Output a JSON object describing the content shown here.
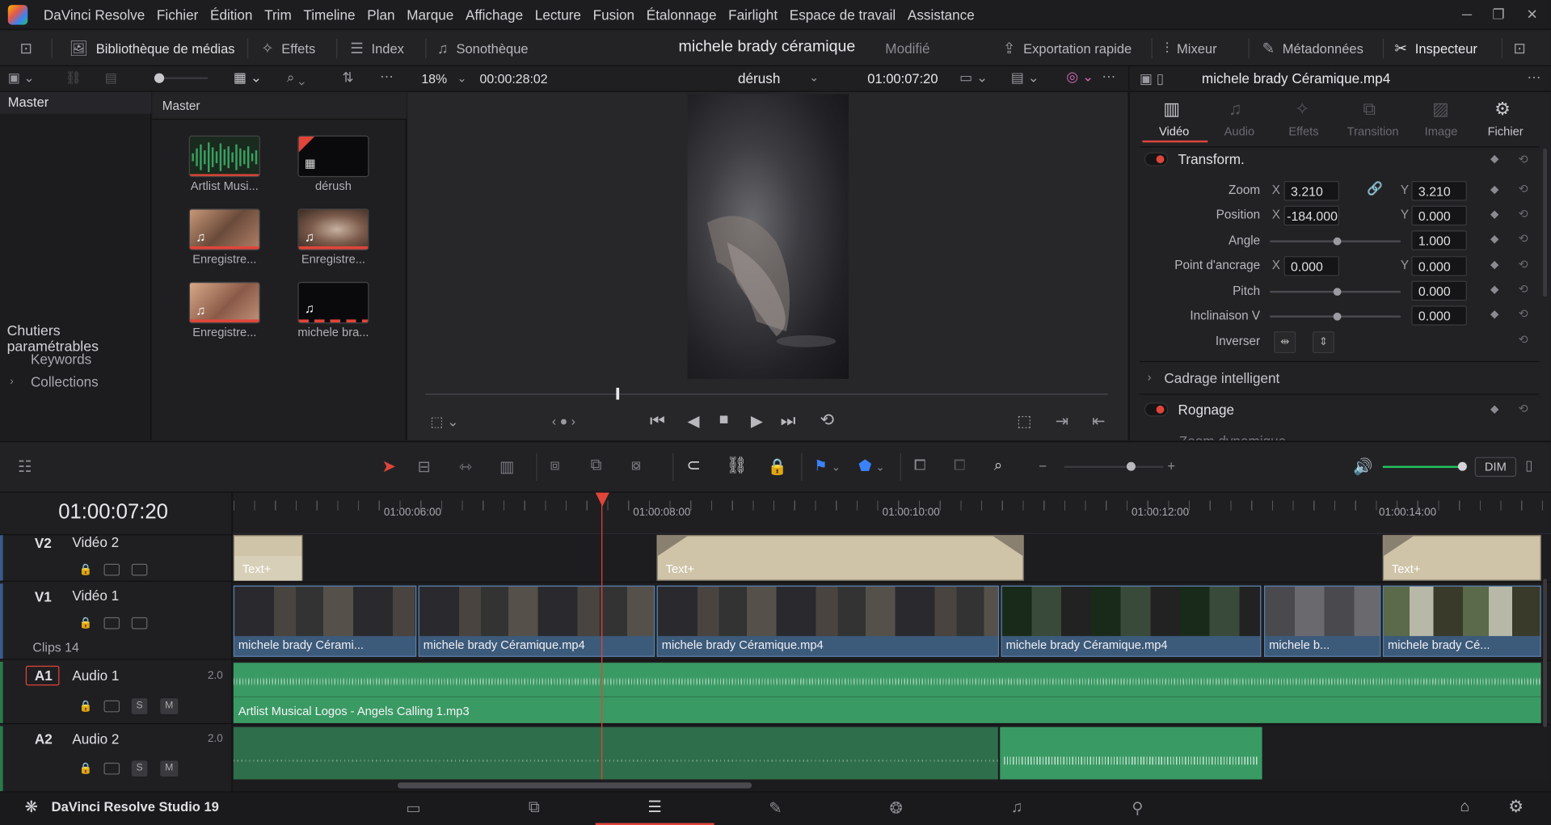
{
  "app": {
    "name": "DaVinci Resolve",
    "footer_name": "DaVinci Resolve Studio 19"
  },
  "menu": [
    "Fichier",
    "Édition",
    "Trim",
    "Timeline",
    "Plan",
    "Marque",
    "Affichage",
    "Lecture",
    "Fusion",
    "Étalonnage",
    "Fairlight",
    "Espace de travail",
    "Assistance"
  ],
  "toolbar": {
    "media_pool": "Bibliothèque de médias",
    "effects": "Effets",
    "index": "Index",
    "sound_library": "Sonothèque",
    "project_title": "michele brady céramique",
    "project_status": "Modifié",
    "quick_export": "Exportation rapide",
    "mixer": "Mixeur",
    "metadata": "Métadonnées",
    "inspector": "Inspecteur"
  },
  "viewer": {
    "zoom": "18%",
    "duration": "00:00:28:02",
    "timeline_name": "dérush",
    "timecode": "01:00:07:20"
  },
  "bins": {
    "master": "Master",
    "smart_bins": "Chutiers paramétrables",
    "keywords": "Keywords",
    "collections": "Collections"
  },
  "media_pool": {
    "header": "Master",
    "items": [
      {
        "label": "Artlist Musi..."
      },
      {
        "label": "dérush"
      },
      {
        "label": "Enregistre..."
      },
      {
        "label": "Enregistre..."
      },
      {
        "label": "Enregistre..."
      },
      {
        "label": "michele bra..."
      }
    ]
  },
  "inspector": {
    "clip_name": "michele brady Céramique.mp4",
    "tabs": [
      "Vidéo",
      "Audio",
      "Effets",
      "Transition",
      "Image",
      "Fichier"
    ],
    "section_transform": "Transform.",
    "zoom_label": "Zoom",
    "zoom_x": "3.210",
    "zoom_y": "3.210",
    "position_label": "Position",
    "position_x": "-184.000",
    "position_y": "0.000",
    "angle_label": "Angle",
    "angle_value": "1.000",
    "anchor_label": "Point d'ancrage",
    "anchor_x": "0.000",
    "anchor_y": "0.000",
    "pitch_label": "Pitch",
    "pitch_value": "0.000",
    "yaw_label": "Inclinaison V",
    "yaw_value": "0.000",
    "flip_label": "Inverser",
    "x_label": "X",
    "y_label": "Y",
    "smart_reframe": "Cadrage intelligent",
    "crop": "Rognage",
    "dynamic_zoom": "Zoom dynamique"
  },
  "timeline": {
    "timecode": "01:00:07:20",
    "ruler_labels": [
      "01:00:06:00",
      "01:00:08:00",
      "01:00:10:00",
      "01:00:12:00",
      "01:00:14:00"
    ],
    "dim": "DIM",
    "tracks": {
      "v2": {
        "id": "V2",
        "name": "Vidéo 2"
      },
      "v1": {
        "id": "V1",
        "name": "Vidéo 1",
        "clips": "Clips 14"
      },
      "a1": {
        "id": "A1",
        "name": "Audio 1",
        "level": "2.0"
      },
      "a2": {
        "id": "A2",
        "name": "Audio 2",
        "level": "2.0"
      }
    },
    "text_clip": "Text+",
    "video_clips": [
      "michele brady Cérami...",
      "michele brady Céramique.mp4",
      "michele brady Céramique.mp4",
      "michele brady Céramique.mp4",
      "michele b...",
      "michele brady Cé..."
    ],
    "audio_clip": "Artlist Musical Logos - Angels Calling 1.mp3",
    "solo": "S",
    "mute": "M"
  },
  "colors": {
    "accent": "#e0453a",
    "playhead": "#e0453a",
    "video_clip": "#3c5a7a",
    "audio_clip": "#3a9a64",
    "text_clip": "#cfc4a8"
  }
}
